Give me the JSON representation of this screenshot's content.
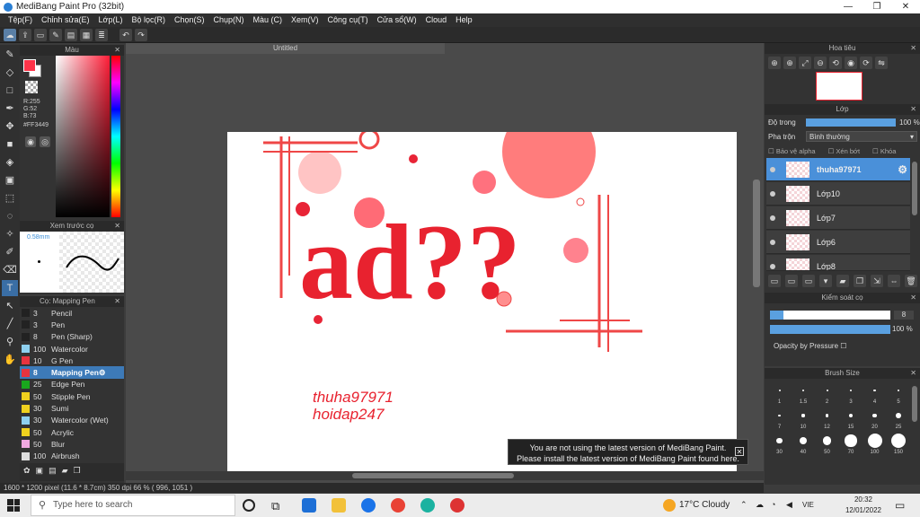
{
  "window": {
    "title": "MediBang Paint Pro (32bit)",
    "min": "—",
    "max": "❐",
    "close": "✕"
  },
  "menu": [
    "Tệp(F)",
    "Chỉnh sửa(E)",
    "Lớp(L)",
    "Bộ lọc(R)",
    "Chọn(S)",
    "Chụp(N)",
    "Màu (C)",
    "Xem(V)",
    "Công cụ(T)",
    "Cửa sổ(W)",
    "Cloud",
    "Help"
  ],
  "color_panel": {
    "title": "Màu",
    "r": "R:255",
    "g": "G:52",
    "b": "B:73",
    "hex": "#FF3449"
  },
  "brush_preview": {
    "title": "Xem trước cọ",
    "size": "0.58mm"
  },
  "brush_list": {
    "title": "Cọ: Mapping Pen",
    "items": [
      {
        "num": "3",
        "name": "Pencil",
        "color": "#222222"
      },
      {
        "num": "3",
        "name": "Pen",
        "color": "#222222"
      },
      {
        "num": "8",
        "name": "Pen (Sharp)",
        "color": "#222222"
      },
      {
        "num": "100",
        "name": "Watercolor",
        "color": "#8ed0f0"
      },
      {
        "num": "10",
        "name": "G Pen",
        "color": "#e8333f"
      },
      {
        "num": "8",
        "name": "Mapping Pen",
        "color": "#e8333f",
        "active": true
      },
      {
        "num": "25",
        "name": "Edge Pen",
        "color": "#19a81d"
      },
      {
        "num": "50",
        "name": "Stipple Pen",
        "color": "#f0d11e"
      },
      {
        "num": "30",
        "name": "Sumi",
        "color": "#f0d11e"
      },
      {
        "num": "30",
        "name": "Watercolor (Wet)",
        "color": "#8ed0f0"
      },
      {
        "num": "50",
        "name": "Acrylic",
        "color": "#f0d11e"
      },
      {
        "num": "50",
        "name": "Blur",
        "color": "#f0a8e0"
      },
      {
        "num": "100",
        "name": "Airbrush",
        "color": "#dddddd"
      }
    ]
  },
  "canvas": {
    "tab": "Untitled",
    "art_letters": "ad??",
    "watermark1": "thuha97971",
    "watermark2": "hoidap247"
  },
  "toast": {
    "line1": "You are not using the latest version of MediBang Paint.",
    "line2": "Please install the latest version of MediBang Paint found here."
  },
  "statusbar": "1600 * 1200 pixel   (11.6 * 8.7cm)   350 dpi   66 %   ( 996, 1051 )",
  "navigator": {
    "title": "Hoa tiêu"
  },
  "layers": {
    "title": "Lớp",
    "opacity_label": "Độ trong",
    "opacity_value": "100 %",
    "blend_label": "Pha trộn",
    "blend_value": "Bình thường",
    "protect_alpha": "Bảo vệ alpha",
    "clip": "Xén bớt",
    "lock": "Khóa",
    "items": [
      {
        "name": "thuha97971",
        "active": true
      },
      {
        "name": "Lớp10"
      },
      {
        "name": "Lớp7"
      },
      {
        "name": "Lớp6"
      },
      {
        "name": "Lớp8"
      }
    ]
  },
  "brush_control": {
    "title": "Kiểm soát cọ",
    "size": "8",
    "opacity": "100 %",
    "size_fill": 0.11,
    "opacity_fill": 1.0,
    "pressure": "Opacity by Pressure"
  },
  "brush_size": {
    "title": "Brush Size",
    "sizes": [
      "1",
      "1.5",
      "2",
      "3",
      "4",
      "5",
      "7",
      "10",
      "12",
      "15",
      "20",
      "25",
      "30",
      "40",
      "50",
      "70",
      "100",
      "150"
    ]
  },
  "taskbar": {
    "search_placeholder": "Type here to search",
    "weather": "17°C  Cloudy",
    "lang": "VIE",
    "time": "20:32",
    "date": "12/01/2022"
  }
}
